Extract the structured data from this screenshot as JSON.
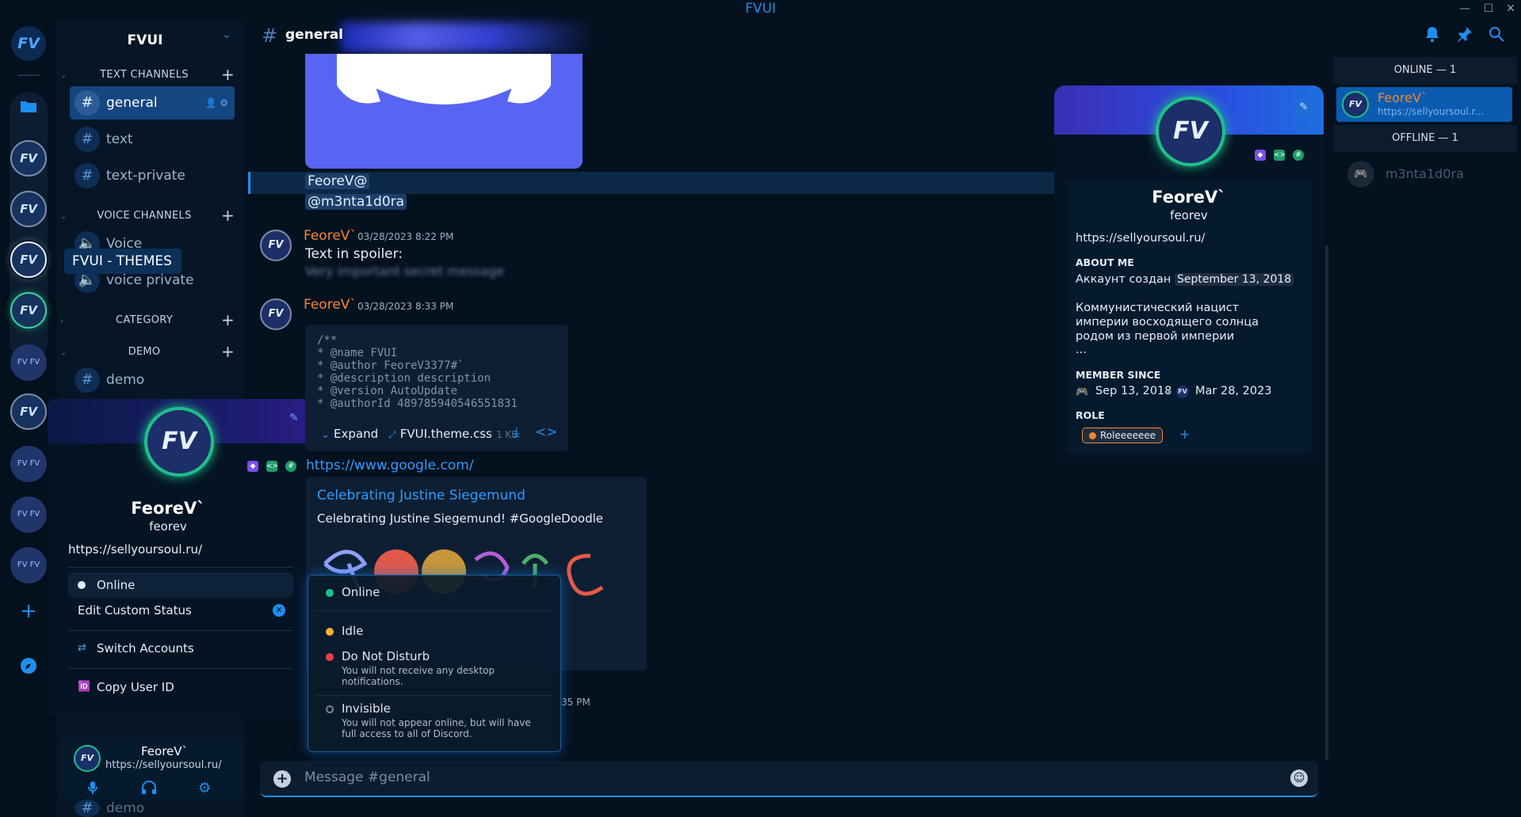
{
  "app": {
    "title": "FVUI"
  },
  "window": {
    "minimize": "—",
    "maximize": "☐",
    "close": "✕"
  },
  "server": {
    "name": "FVUI",
    "logo_text": "FV"
  },
  "rail": {
    "tooltip": "FVUI - THEMES",
    "server_initials": "FV",
    "mini_initials": "FV FV"
  },
  "sidebar": {
    "categories": {
      "text": "TEXT CHANNELS",
      "voice": "VOICE CHANNELS",
      "category": "CATEGORY",
      "demo": "DEMO"
    },
    "channels": {
      "general": "general",
      "text": "text",
      "text_private": "text-private",
      "voice": "Voice",
      "voice_private": "voice private",
      "demo": "demo",
      "demo_bottom": "demo"
    }
  },
  "popout_left": {
    "avatar_initials": "FV",
    "display_name": "FeoreV`",
    "username": "feorev",
    "link": "https://sellyoursoul.ru/",
    "status": "Online",
    "edit_status": "Edit Custom Status",
    "switch_accounts": "Switch Accounts",
    "copy_id": "Copy User ID"
  },
  "user_panel": {
    "name": "FeoreV`",
    "status": "https://sellyoursoul.ru/",
    "avatar_initials": "FV"
  },
  "header": {
    "channel": "general"
  },
  "messages": {
    "mention_name": "FeoreV@",
    "mention_user": "@m3nta1d0ra",
    "m1_author": "FeoreV`",
    "m1_time": "03/28/2023 8:22 PM",
    "m1_text": "Text in spoiler:",
    "m1_spoiler": "Very important secret message",
    "m2_author": "FeoreV`",
    "m2_time": "03/28/2023 8:33 PM",
    "code_lines": [
      "/**",
      " * @name FVUI",
      " * @author FeoreV3377#`",
      " * @description description",
      " * @version  AutoUpdate",
      " * @authorId 489785940546551831"
    ],
    "code_expand": "Expand",
    "code_file": "FVUI.theme.css",
    "code_size": "1 KB",
    "link": "https://www.google.com/",
    "embed_title": "Celebrating Justine Siegemund",
    "embed_desc": "Celebrating Justine Siegemund! #GoogleDoodle",
    "partial_time": "35 PM"
  },
  "status_menu": {
    "online": "Online",
    "idle": "Idle",
    "dnd": "Do Not Disturb",
    "dnd_desc": "You will not receive any desktop notifications.",
    "invisible": "Invisible",
    "invisible_desc": "You will not appear online, but will have full access to all of Discord."
  },
  "composer": {
    "placeholder": "Message #general"
  },
  "profile_right": {
    "avatar_initials": "FV",
    "display_name": "FeoreV`",
    "username": "feorev",
    "link": "https://sellyoursoul.ru/",
    "about_header": "ABOUT ME",
    "about_line1": "Аккаунт создан",
    "about_date": "September 13, 2018",
    "about_bio": "Коммунистический нацист империи восходящего солнца родом из первой империи",
    "about_more": "...",
    "member_since_header": "MEMBER SINCE",
    "discord_since": "Sep 13, 2018",
    "server_since": "Mar 28, 2023",
    "role_header": "ROLE",
    "role": "Roleeeeeee",
    "add_role": "+"
  },
  "members": {
    "online_header": "ONLINE — 1",
    "offline_header": "OFFLINE — 1",
    "online_name": "FeoreV`",
    "online_sub": "https://sellyoursoul.r...",
    "offline_name": "m3nta1d0ra"
  },
  "colors": {
    "accent": "#1d8ff0",
    "author": "#f5862f",
    "online": "#1ec08a",
    "idle": "#f0b232",
    "dnd": "#f23f43",
    "invisible": "#80848e",
    "blurple": "#5865f2"
  }
}
